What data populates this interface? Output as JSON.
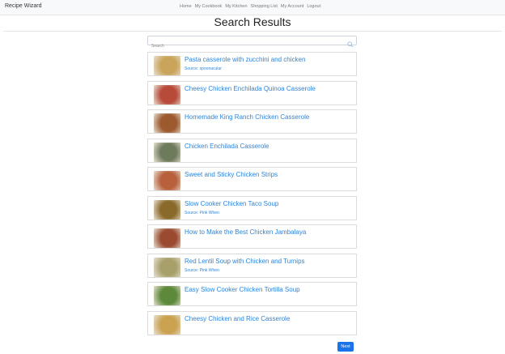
{
  "app": {
    "brand": "Recipe Wizard"
  },
  "nav": [
    "Home",
    "My Cookbook",
    "My Kitchen",
    "Shopping List",
    "My Account",
    "Logout"
  ],
  "page": {
    "title": "Search Results"
  },
  "search": {
    "placeholder": "Search",
    "value": ""
  },
  "results": [
    {
      "title": "Pasta casserole with zucchini and chicken",
      "source": "Source: spoonacular",
      "thumb_color": "#c9a45a"
    },
    {
      "title": "Cheesy Chicken Enchilada Quinoa Casserole",
      "source": "",
      "thumb_color": "#b84a3a"
    },
    {
      "title": "Homemade King Ranch Chicken Casserole",
      "source": "",
      "thumb_color": "#9c5a2e"
    },
    {
      "title": "Chicken Enchilada Casserole",
      "source": "",
      "thumb_color": "#6e7a5c"
    },
    {
      "title": "Sweet and Sticky Chicken Strips",
      "source": "",
      "thumb_color": "#b8603c"
    },
    {
      "title": "Slow Cooker Chicken Taco Soup",
      "source": "Source: Pink When",
      "thumb_color": "#8a6a2a"
    },
    {
      "title": "How to Make the Best Chicken Jambalaya",
      "source": "",
      "thumb_color": "#9a4a30"
    },
    {
      "title": "Red Lentil Soup with Chicken and Turnips",
      "source": "Source: Pink When",
      "thumb_color": "#a8a06a"
    },
    {
      "title": "Easy Slow Cooker Chicken Tortilla Soup",
      "source": "",
      "thumb_color": "#5c8a3a"
    },
    {
      "title": "Cheesy Chicken and Rice Casserole",
      "source": "",
      "thumb_color": "#caa250"
    }
  ],
  "pagination": {
    "next_label": "Next"
  },
  "colors": {
    "link": "#2f84d8",
    "accent": "#1a73e8",
    "navbar_bg": "#f8f9fa"
  }
}
